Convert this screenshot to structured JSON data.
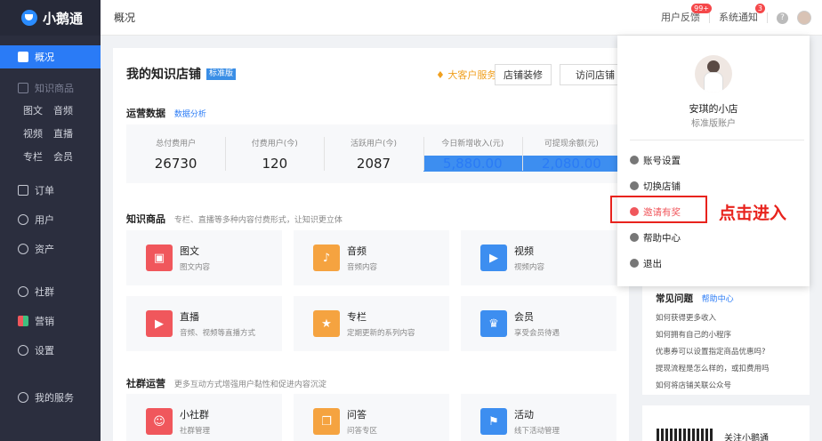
{
  "app": {
    "name": "小鹅通"
  },
  "sidebar": {
    "overview": "概况",
    "products": "知识商品",
    "sub1": [
      "图文",
      "音频"
    ],
    "sub2": [
      "视频",
      "直播"
    ],
    "sub3": [
      "专栏",
      "会员"
    ],
    "orders": "订单",
    "users": "用户",
    "assets": "资产",
    "community": "社群",
    "marketing": "营销",
    "settings": "设置",
    "myservice": "我的服务"
  },
  "topbar": {
    "title": "概况",
    "feedback": "用户反馈",
    "feedback_badge": "99+",
    "notice": "系统通知",
    "notice_badge": "3",
    "help_icon": "?"
  },
  "store": {
    "title": "我的知识店铺",
    "tag": "标准版",
    "vip": "大客户服务",
    "decorate": "店铺装修",
    "visit": "访问店铺"
  },
  "ops": {
    "label": "运营数据",
    "link": "数据分析",
    "stats": [
      {
        "label": "总付费用户",
        "value": "26730"
      },
      {
        "label": "付费用户(今)",
        "value": "120"
      },
      {
        "label": "活跃用户(今)",
        "value": "2087"
      },
      {
        "label": "今日新增收入(元)",
        "value": "5,880.00"
      },
      {
        "label": "可提现余额(元)",
        "value": "2,080.00"
      }
    ]
  },
  "knowledge": {
    "label": "知识商品",
    "desc": "专栏、直播等多种内容付费形式，让知识更立体",
    "cards": [
      {
        "name": "图文",
        "desc": "图文内容"
      },
      {
        "name": "音频",
        "desc": "音频内容"
      },
      {
        "name": "视频",
        "desc": "视频内容"
      },
      {
        "name": "直播",
        "desc": "音频、视频等直播方式"
      },
      {
        "name": "专栏",
        "desc": "定期更新的系列内容"
      },
      {
        "name": "会员",
        "desc": "享受会员待遇"
      }
    ]
  },
  "community": {
    "label": "社群运营",
    "desc": "更多互动方式增强用户黏性和促进内容沉淀",
    "cards": [
      {
        "name": "小社群",
        "desc": "社群管理"
      },
      {
        "name": "问答",
        "desc": "问答专区"
      },
      {
        "name": "活动",
        "desc": "线下活动管理"
      }
    ]
  },
  "dropdown": {
    "shop_name": "安琪的小店",
    "shop_type": "标准版账户",
    "items": [
      "账号设置",
      "切换店铺",
      "邀请有奖",
      "帮助中心",
      "退出"
    ]
  },
  "annotation": "点击进入",
  "faq": {
    "title": "常见问题",
    "link": "帮助中心",
    "items": [
      "如何获得更多收入",
      "如何拥有自己的小程序",
      "优惠券可以设置指定商品优惠吗?",
      "提现流程是怎么样的，或扣费用吗",
      "如何将店铺关联公众号"
    ]
  },
  "follow": {
    "text": "关注小鹅通"
  },
  "colors": {
    "accent": "#2a7bf6",
    "sidebar": "#2b2e3e",
    "annotation": "#e8231d"
  }
}
